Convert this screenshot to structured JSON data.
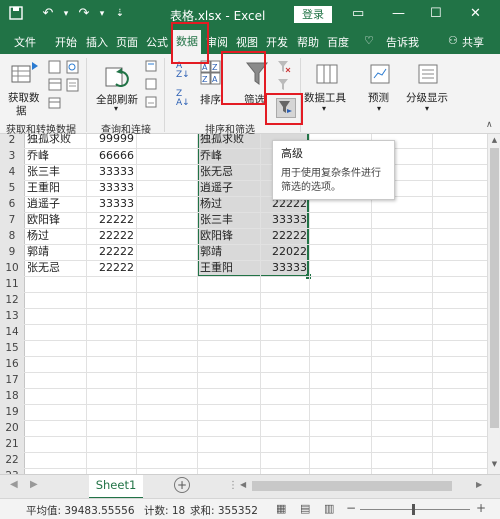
{
  "titlebar": {
    "title": "表格.xlsx  -  Excel",
    "login": "登录",
    "brand_color": "#217346",
    "icons": [
      "save-icon",
      "undo-icon",
      "redo-icon",
      "customize-icon"
    ]
  },
  "tabs": [
    "文件",
    "开始",
    "插入",
    "页面",
    "公式",
    "数据",
    "审阅",
    "视图",
    "开发",
    "帮助",
    "百度",
    "告诉我",
    "共享"
  ],
  "ribbon": {
    "get_data": "获取数",
    "get_data_2": "据",
    "refresh_all": "全部刷新",
    "sort": "排序",
    "filter": "筛选",
    "data_tools": "数据工具",
    "forecast": "预测",
    "outline": "分级显示",
    "groups": {
      "get_transform": "获取和转换数据",
      "queries": "查询和连接",
      "sort_filter": "排序和筛选"
    }
  },
  "tooltip": {
    "title": "高级",
    "desc1": "用于使用复杂条件进行",
    "desc2": "筛选的选项。"
  },
  "rows": [
    "2",
    "3",
    "4",
    "5",
    "6",
    "7",
    "8",
    "9",
    "10",
    "11",
    "12",
    "13",
    "14",
    "15",
    "16",
    "17",
    "18",
    "19",
    "20",
    "21",
    "22",
    "23"
  ],
  "colA": [
    [
      "独孤求败",
      "99999"
    ],
    [
      "乔峰",
      "66666"
    ],
    [
      "张三丰",
      "33333"
    ],
    [
      "王重阳",
      "33333"
    ],
    [
      "逍遥子",
      "33333"
    ],
    [
      "欧阳锋",
      "22222"
    ],
    [
      "杨过",
      "22222"
    ],
    [
      "郭靖",
      "22222"
    ],
    [
      "张无忌",
      "22222"
    ]
  ],
  "colE": [
    [
      "独孤求败",
      ""
    ],
    [
      "乔峰",
      ""
    ],
    [
      "张无忌",
      ""
    ],
    [
      "逍遥子",
      ""
    ],
    [
      "杨过",
      "22222"
    ],
    [
      "张三丰",
      "33333"
    ],
    [
      "欧阳锋",
      "22222"
    ],
    [
      "郭靖",
      "22022"
    ],
    [
      "王重阳",
      "33333"
    ]
  ],
  "sheet": {
    "name": "Sheet1"
  },
  "status": {
    "avg": "平均值: 39483.55556",
    "count": "计数: 18",
    "sum": "求和: 355352"
  }
}
